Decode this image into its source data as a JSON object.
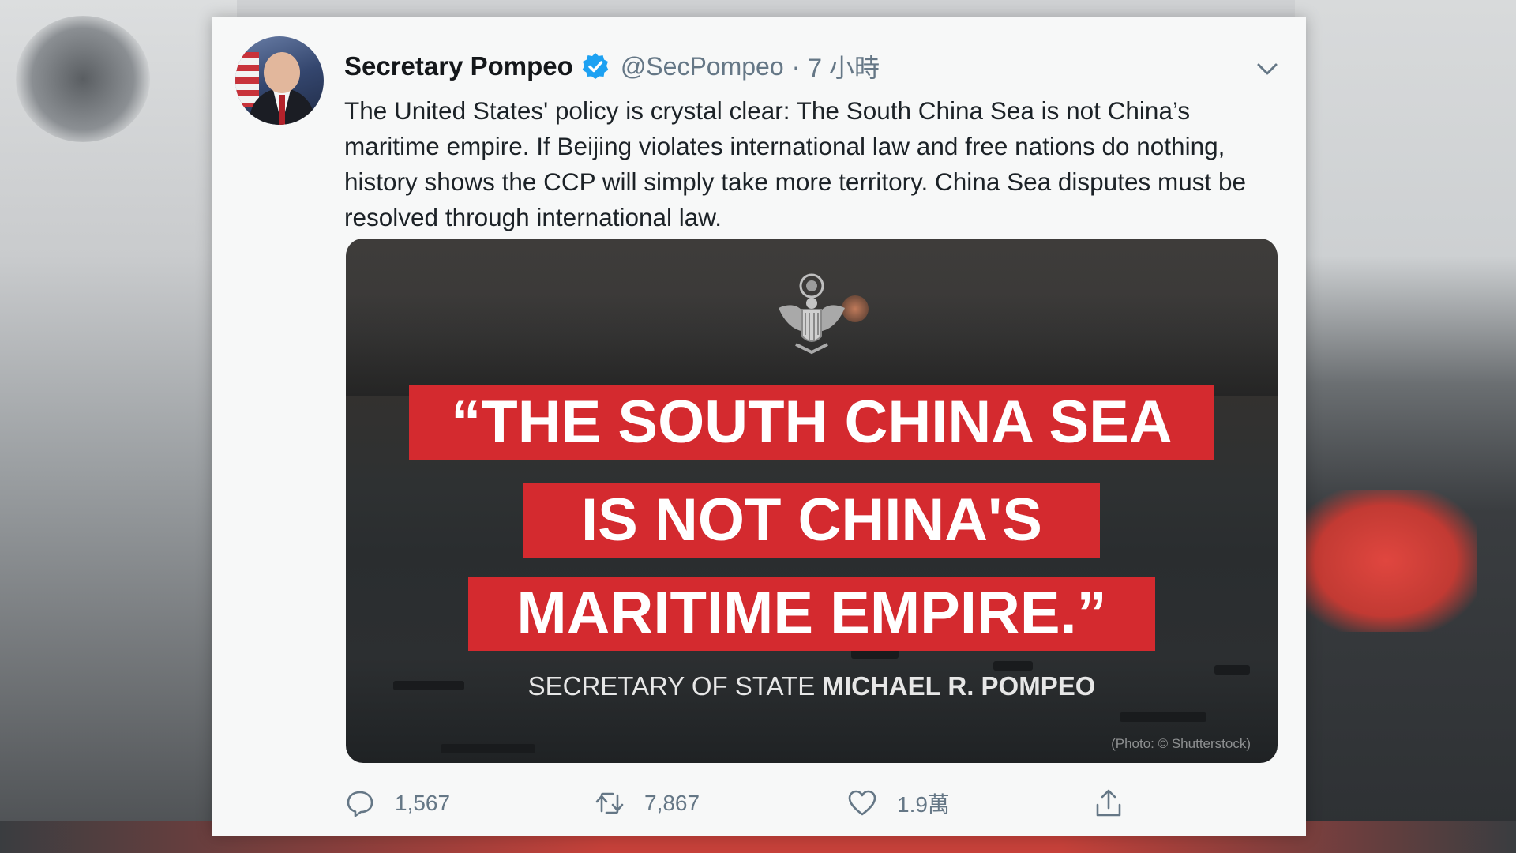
{
  "tweet": {
    "display_name": "Secretary Pompeo",
    "handle": "@SecPompeo",
    "separator": "·",
    "time": "7 小時",
    "text": "The United States' policy is crystal clear: The South China Sea is not China’s maritime empire. If Beijing violates international law and free nations do nothing, history shows the CCP will simply take more territory. China Sea disputes must be resolved through international law.",
    "icons": {
      "verified": "verified-badge-icon",
      "menu": "chevron-down-icon"
    }
  },
  "media": {
    "quote_line1": "“THE SOUTH CHINA SEA",
    "quote_line2": "IS NOT CHINA'S",
    "quote_line3": "MARITIME EMPIRE.”",
    "attribution_prefix": "SECRETARY OF STATE ",
    "attribution_name": "MICHAEL R. POMPEO",
    "photo_credit": "(Photo: © Shutterstock)",
    "banner_color": "#d42a2f"
  },
  "actions": {
    "reply_count": "1,567",
    "retweet_count": "7,867",
    "like_count": "1.9萬",
    "icons": {
      "reply": "reply-icon",
      "retweet": "retweet-icon",
      "like": "heart-icon",
      "share": "share-icon"
    }
  },
  "colors": {
    "twitter_blue": "#1da1f2",
    "secondary_text": "#657786"
  }
}
